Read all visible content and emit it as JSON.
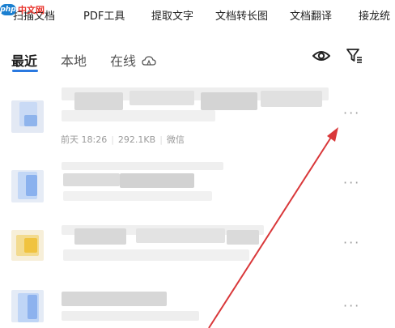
{
  "watermark": {
    "logo": "php",
    "text": "中文网"
  },
  "toolbar": {
    "items": [
      "扫描文档",
      "PDF工具",
      "提取文字",
      "文档转长图",
      "文档翻译",
      "接龙统"
    ]
  },
  "tabs": {
    "recent": "最近",
    "local": "本地",
    "online": "在线"
  },
  "files": [
    {
      "meta_date": "前天 18:26",
      "meta_size": "292.1KB",
      "meta_source": "微信",
      "more": "···"
    },
    {
      "more": "···"
    },
    {
      "more": "···"
    },
    {
      "more": "···"
    }
  ],
  "colors": {
    "accent": "#2a79e0",
    "arrow": "#d9383a"
  }
}
